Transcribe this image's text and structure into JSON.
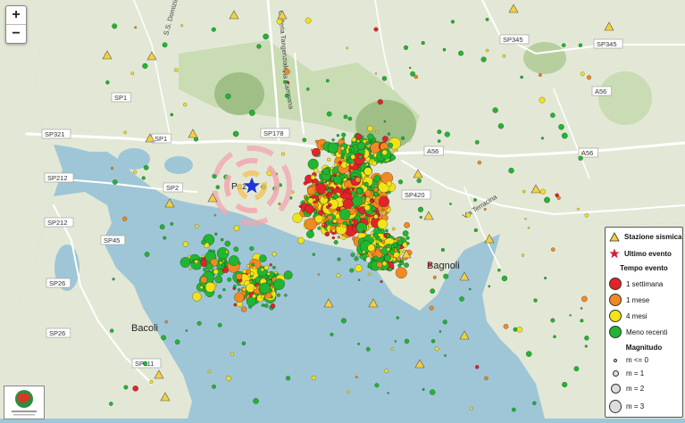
{
  "zoom": {
    "in_label": "+",
    "out_label": "−"
  },
  "place_labels": {
    "pozzuoli": "Poz",
    "bagnoli": "Bagnoli",
    "bacoli": "Bacoli"
  },
  "road_labels": {
    "sp345_a": "SP345",
    "sp345_b": "SP345",
    "a56_a": "A56",
    "a56_b": "A56",
    "a56_c": "A56",
    "sp1_a": "SP1",
    "sp1_b": "SP1",
    "sp178": "SP178",
    "sp321": "SP321",
    "sp212_a": "SP212",
    "sp212_b": "SP212",
    "sp2": "SP2",
    "sp45": "SP45",
    "sp26_a": "SP26",
    "sp26_b": "SP26",
    "sp111": "SP111",
    "sp420": "SP420",
    "galleria": "Galleria Tangenziale",
    "campana": "Via Campana",
    "domiziana": "S.S. Domiziana",
    "terracina": "Via Terracina"
  },
  "legend": {
    "station_label": "Stazione sismica",
    "last_event_label": "Ultimo evento",
    "time_title": "Tempo evento",
    "time_items": [
      {
        "label": "1 settimana",
        "color": "#e2232a"
      },
      {
        "label": "1 mese",
        "color": "#f08a24"
      },
      {
        "label": "4 mesi",
        "color": "#f2e21a"
      },
      {
        "label": "Meno recenti",
        "color": "#22b531"
      }
    ],
    "magnitude_title": "Magnitudo",
    "magnitude_items": [
      {
        "label": "m <= 0"
      },
      {
        "label": "m = 1"
      },
      {
        "label": "m = 2"
      },
      {
        "label": "m = 3"
      }
    ]
  },
  "colors": {
    "sea": "#9fc6d6",
    "land": "#e4e8d8",
    "station": "#f4d03f",
    "last_event": "#1f35d6",
    "ring": "#f3a6b0"
  }
}
